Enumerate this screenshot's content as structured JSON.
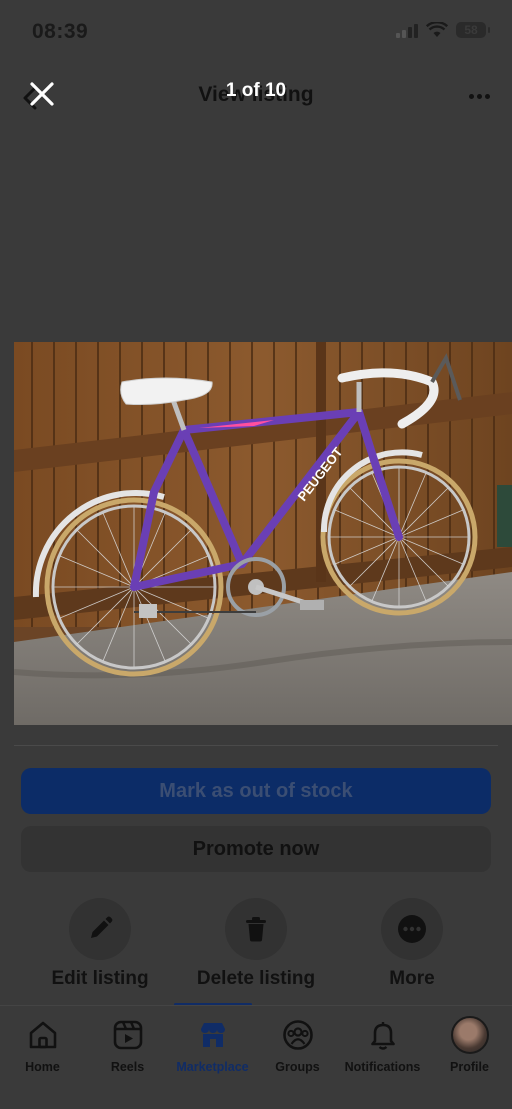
{
  "status_bar": {
    "time": "08:39",
    "battery": "58"
  },
  "header": {
    "title": "View listing"
  },
  "viewer": {
    "counter": "1 of 10",
    "photo_brand_text": "PEUGEOT"
  },
  "buttons": {
    "primary": "Mark as out of stock",
    "secondary": "Promote now"
  },
  "actions": [
    {
      "label": "Edit listing",
      "icon": "pencil-icon"
    },
    {
      "label": "Delete listing",
      "icon": "trash-icon"
    },
    {
      "label": "More",
      "icon": "more-icon"
    }
  ],
  "tabs": [
    {
      "label": "Home",
      "icon": "home-icon"
    },
    {
      "label": "Reels",
      "icon": "reels-icon"
    },
    {
      "label": "Marketplace",
      "icon": "marketplace-icon",
      "active": true
    },
    {
      "label": "Groups",
      "icon": "groups-icon"
    },
    {
      "label": "Notifications",
      "icon": "bell-icon"
    },
    {
      "label": "Profile",
      "icon": "avatar"
    }
  ],
  "colors": {
    "overlay_bg": "#3a3a3a",
    "accent": "#0c2c67",
    "frame": "#6a3fb5"
  }
}
